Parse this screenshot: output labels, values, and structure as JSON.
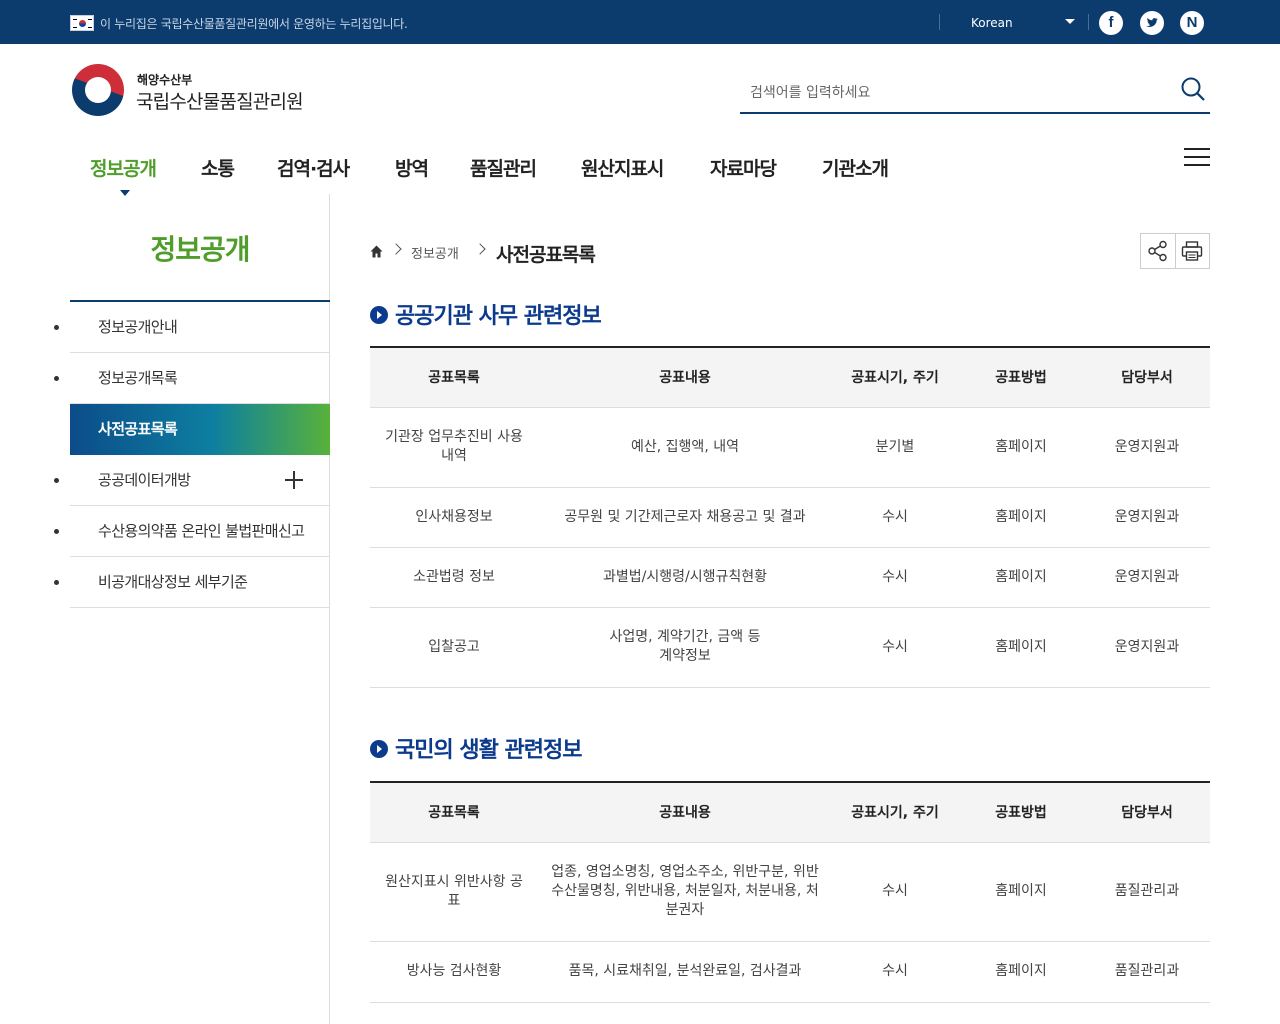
{
  "topbar": {
    "notice": "이 누리집은 국립수산물품질관리원에서 운영하는 누리집입니다.",
    "language": "Korean",
    "sns": [
      "facebook-icon",
      "twitter-icon",
      "naver-icon"
    ],
    "sns_glyphs": [
      "f",
      "t",
      "N"
    ]
  },
  "header": {
    "ministry": "해양수산부",
    "org_name": "국립수산물품질관리원",
    "search_placeholder": "검색어를 입력하세요"
  },
  "gnb": [
    "정보공개",
    "소통",
    "검역·검사",
    "방역",
    "품질관리",
    "원산지표시",
    "자료마당",
    "기관소개"
  ],
  "lnb": {
    "title": "정보공개",
    "items": [
      "정보공개안내",
      "정보공개목록",
      "사전공표목록",
      "공공데이터개방",
      "수산용의약품 온라인 불법판매신고",
      "비공개대상정보 세부기준"
    ]
  },
  "breadcrumb": {
    "level1": "정보공개",
    "current": "사전공표목록"
  },
  "section1": {
    "title": "공공기관 사무 관련정보",
    "headers": [
      "공표목록",
      "공표내용",
      "공표시기, 주기",
      "공표방법",
      "담당부서"
    ],
    "rows": [
      [
        "기관장 업무추진비 사용\n내역",
        "예산, 집행액, 내역",
        "분기별",
        "홈페이지",
        "운영지원과"
      ],
      [
        "인사채용정보",
        "공무원 및 기간제근로자 채용공고 및 결과",
        "수시",
        "홈페이지",
        "운영지원과"
      ],
      [
        "소관법령 정보",
        "과별법/시행령/시행규칙현황",
        "수시",
        "홈페이지",
        "운영지원과"
      ],
      [
        "입찰공고",
        "사업명, 계약기간, 금액 등\n계약정보",
        "수시",
        "홈페이지",
        "운영지원과"
      ]
    ]
  },
  "section2": {
    "title": "국민의 생활 관련정보",
    "headers": [
      "공표목록",
      "공표내용",
      "공표시기, 주기",
      "공표방법",
      "담당부서"
    ],
    "rows": [
      [
        "원산지표시 위반사항 공\n표",
        "업종, 영업소명칭, 영업소주소, 위반구분, 위반\n수산물명칭, 위반내용, 처분일자, 처분내용, 처\n분권자",
        "수시",
        "홈페이지",
        "품질관리과"
      ],
      [
        "방사능 검사현황",
        "품목, 시료채취일, 분석완료일, 검사결과",
        "수시",
        "홈페이지",
        "품질관리과"
      ]
    ]
  }
}
